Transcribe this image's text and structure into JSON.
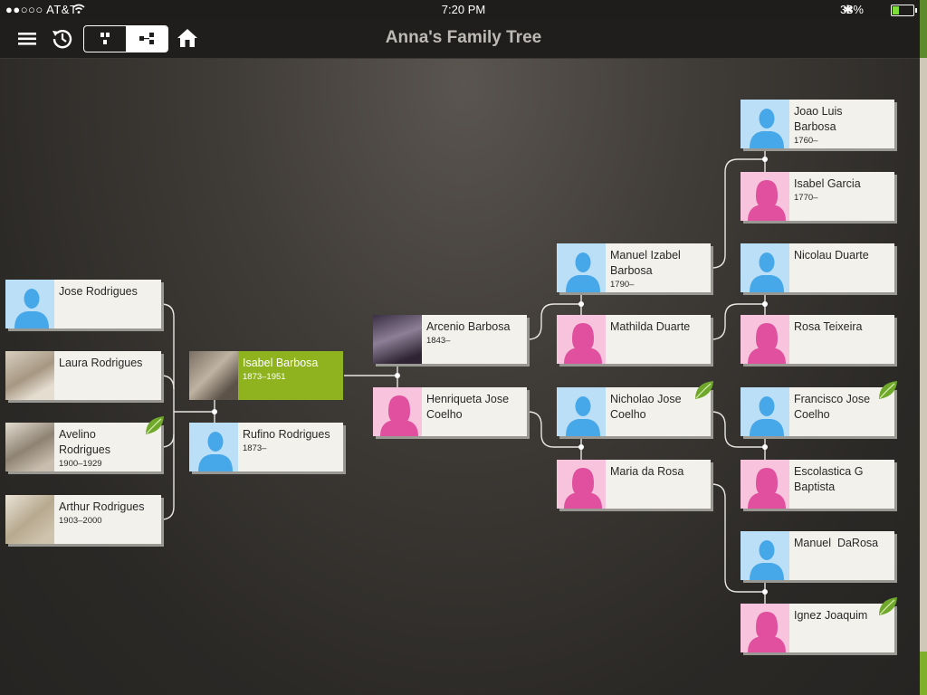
{
  "status_bar": {
    "carrier": "●●○○○ AT&T",
    "time": "7:20 PM",
    "battery": "33%"
  },
  "nav": {
    "title": "Anna's Family Tree"
  },
  "icons": {
    "menu": "hamburger-icon",
    "history": "history-clock-icon",
    "pedigree": "pedigree-view-icon",
    "family": "family-view-icon",
    "home": "home-icon"
  },
  "colors": {
    "male": "#46a8e8",
    "female": "#e0509e",
    "selected": "#8fb31f"
  },
  "people": {
    "jose_rodrigues": {
      "name": "Jose Rodrigues",
      "dates": ""
    },
    "laura_rodrigues": {
      "name": "Laura Rodrigues",
      "dates": ""
    },
    "avelino_rodrigues": {
      "name": "Avelino Rodrigues",
      "dates": "1900–1929"
    },
    "arthur_rodrigues": {
      "name": "Arthur Rodrigues",
      "dates": "1903–2000"
    },
    "isabel_barbosa": {
      "name": "Isabel Barbosa",
      "dates": "1873–1951"
    },
    "rufino_rodrigues": {
      "name": "Rufino Rodrigues",
      "dates": "1873–"
    },
    "arcenio_barbosa": {
      "name": "Arcenio Barbosa",
      "dates": "1843–"
    },
    "henriqueta_coelho": {
      "name": "Henriqueta Jose Coelho",
      "dates": ""
    },
    "manuel_izabel_barbosa": {
      "name": "Manuel Izabel Barbosa",
      "dates": "1790–"
    },
    "mathilda_duarte": {
      "name": "Mathilda Duarte",
      "dates": ""
    },
    "nicholao_coelho": {
      "name": "Nicholao Jose Coelho",
      "dates": ""
    },
    "maria_da_rosa": {
      "name": "Maria da Rosa",
      "dates": ""
    },
    "joao_luis_barbosa": {
      "name": "Joao Luis Barbosa",
      "dates": "1760–"
    },
    "isabel_garcia": {
      "name": "Isabel Garcia",
      "dates": "1770–"
    },
    "nicolau_duarte": {
      "name": "Nicolau Duarte",
      "dates": ""
    },
    "rosa_teixeira": {
      "name": "Rosa Teixeira",
      "dates": ""
    },
    "francisco_coelho": {
      "name": "Francisco Jose Coelho",
      "dates": ""
    },
    "escolastica_baptista": {
      "name": "Escolastica G Baptista",
      "dates": ""
    },
    "manuel_darosa": {
      "name": "Manuel  DaRosa",
      "dates": ""
    },
    "ignez_joaquim": {
      "name": "Ignez Joaquim",
      "dates": ""
    }
  }
}
